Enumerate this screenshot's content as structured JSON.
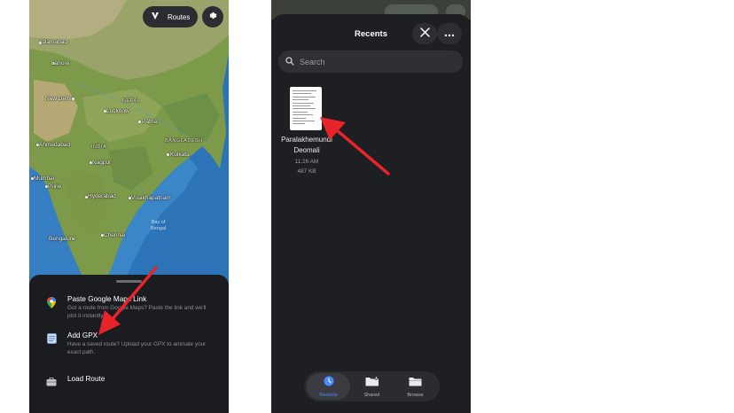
{
  "left_screen": {
    "top_buttons": {
      "routes_label": "Routes",
      "routes_icon": "route-icon",
      "settings_icon": "gear-icon"
    },
    "map_labels": {
      "islamabad": "Islamabad",
      "lahore": "Lahore",
      "new_delhi": "New Delhi",
      "lucknow": "Lucknow",
      "nepal": "NEPAL",
      "patna": "Patna",
      "bangladesh": "BANGLADESH",
      "ahmedabad": "Ahmedabad",
      "india": "INDIA",
      "kolkata": "Kolkata",
      "nagpur": "Nagpur",
      "mumbai": "Mumbai",
      "pune": "Pune",
      "hyderabad": "Hyderabad",
      "visakhapatnam": "Visakhapatnam",
      "bay_of_bengal": "Bay of\nBengal",
      "bengaluru": "Bengaluru",
      "chennai": "Chennai"
    },
    "sheet": {
      "items": [
        {
          "icon": "google-maps-pin-icon",
          "title": "Paste Google Maps Link",
          "description": "Got a route from Google Maps? Paste the link and we'll plot it instantly."
        },
        {
          "icon": "gpx-file-icon",
          "title": "Add GPX",
          "description": "Have a saved route? Upload your GPX to animate your exact path."
        },
        {
          "icon": "briefcase-icon",
          "title": "Load Route",
          "description": ""
        }
      ]
    }
  },
  "right_screen": {
    "title": "Recents",
    "close_icon": "close-icon",
    "more_icon": "more-icon",
    "search": {
      "placeholder": "Search"
    },
    "file": {
      "name_line1": "Paralakhemundi",
      "name_line2": "Deomali",
      "time": "11:26 AM",
      "size": "487 KB"
    },
    "tabs": [
      {
        "label": "Recents",
        "icon": "clock-icon",
        "active": true
      },
      {
        "label": "Shared",
        "icon": "shared-folder-icon",
        "active": false
      },
      {
        "label": "Browse",
        "icon": "folder-icon",
        "active": false
      }
    ]
  },
  "colors": {
    "annotation_arrow": "#e8232a",
    "sheet_background": "#1b1c20",
    "files_background": "#1e1f22",
    "active_tab": "#4a8cff"
  }
}
